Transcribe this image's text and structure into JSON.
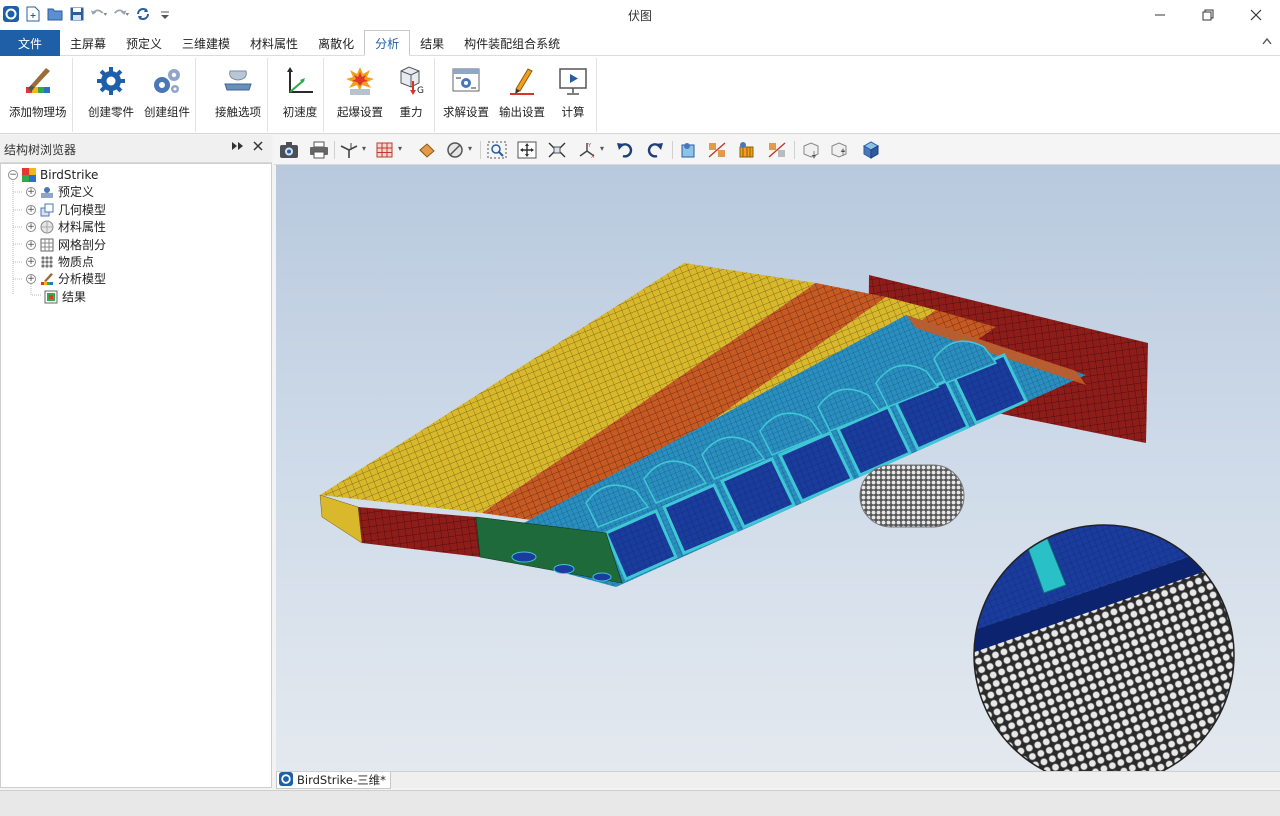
{
  "app": {
    "title": "伏图"
  },
  "quick_access": [
    "app-logo-icon",
    "new-icon",
    "open-folder-icon",
    "save-icon",
    "undo-icon",
    "redo-icon",
    "refresh-icon",
    "customize-icon"
  ],
  "menu": {
    "file": "文件",
    "tabs": [
      "主屏幕",
      "预定义",
      "三维建模",
      "材料属性",
      "离散化",
      "分析",
      "结果",
      "构件装配组合系统"
    ],
    "active_tab": "分析"
  },
  "ribbon": {
    "buttons": [
      {
        "label": "添加物理场",
        "icon": "paint-brush-icon"
      },
      {
        "label": "创建零件",
        "icon": "gear-icon"
      },
      {
        "label": "创建组件",
        "icon": "gears-icon"
      },
      {
        "label": "接触选项",
        "icon": "contact-plate-icon"
      },
      {
        "label": "初速度",
        "icon": "velocity-axes-icon"
      },
      {
        "label": "起爆设置",
        "icon": "explosion-icon"
      },
      {
        "label": "重力",
        "icon": "gravity-cube-icon"
      },
      {
        "label": "求解设置",
        "icon": "solver-settings-icon"
      },
      {
        "label": "输出设置",
        "icon": "output-pen-icon"
      },
      {
        "label": "计算",
        "icon": "compute-play-icon"
      }
    ]
  },
  "structure_panel": {
    "title": "结构树浏览器",
    "root": "BirdStrike",
    "children": [
      "预定义",
      "几何模型",
      "材料属性",
      "网格剖分",
      "物质点",
      "分析模型",
      "结果"
    ]
  },
  "viewport": {
    "document_tab": "BirdStrike-三维*",
    "colors": {
      "wing_yellow": "#d9b92b",
      "wing_orange": "#c75a22",
      "wing_red": "#8e1d1a",
      "skin_blue": "#1a3c9c",
      "rib_cyan": "#22a6b8",
      "bird_gray": "#9a9a9a"
    }
  }
}
